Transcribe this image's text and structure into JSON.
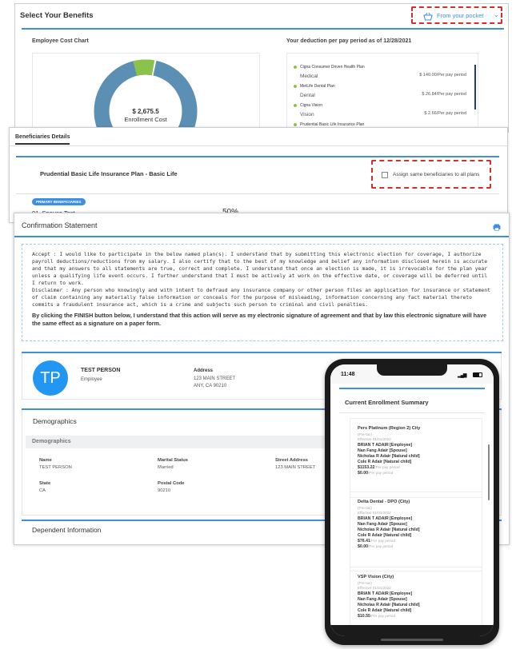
{
  "benefits": {
    "title": "Select Your Benefits",
    "pocket_label": "From your pocket",
    "cost_chart_title": "Employee Cost Chart",
    "total_amount": "$ 2,675.5",
    "total_label": "Enrollment Cost",
    "deduction_title": "Your deduction per pay period as of 12/28/2021",
    "plans": [
      {
        "name": "Cigna Consumer Driven Health Plan",
        "type": "Medical",
        "amount": "$ 140.00/Per pay period"
      },
      {
        "name": "MetLife Dental Plan",
        "type": "Dental",
        "amount": "$ 26.84/Per pay period"
      },
      {
        "name": "Cigna Vision",
        "type": "Vision",
        "amount": "$ 2.66/Per pay period"
      },
      {
        "name": "Prudential Basic Life Insurance Plan",
        "type": "",
        "amount": ""
      }
    ]
  },
  "beneficiaries": {
    "tab_label": "Beneficiaries Details",
    "plan_title": "Prudential Basic Life Insurance Plan - Basic Life",
    "assign_label": "Assign same beneficiaries to all plans",
    "primary_badge": "PRIMARY BENEFICIARIES",
    "first_name": "01. Spouse Test",
    "first_percent": "50%"
  },
  "confirmation": {
    "title": "Confirmation Statement",
    "accept_text": "Accept : I would like to participate in the below named plan(s). I understand that by submitting this electronic election for coverage, I authorize payroll deductions/reductions from my salary. I also certify that to the best of my knowledge and belief any information disclosed herein is accurate and that my answers to all statements are true, correct and complete. I understand that once an election is made, it is irrevocable for the plan year unless a qualifying life event occurs. I further understand that I must be actively at work on the effective date, or coverage will be deferred until I return to work.",
    "disclaimer_text": "Disclaimer : Any person who knowingly and with intent to defraud any insurance company or other person files an application for insurance or statement of claim containing any materially false information or conceals for the purpose of misleading, information concerning any fact material thereto commits a fraudulent insurance act, which is a crime and subjects such person to criminal and civil penalties.",
    "finish_text": "By clicking the FINISH button below, I understand that this action will serve as my electronic signature of agreement and that by law this electronic signature will have the same effect as a signature on a paper form."
  },
  "person": {
    "initials": "TP",
    "name": "TEST PERSON",
    "role": "Employee",
    "address_label": "Address",
    "address_line1": "123 MAIN STREET",
    "address_line2": "ANY, CA  90210"
  },
  "demographics": {
    "section_title": "Demographics",
    "sub_header": "Demographics",
    "fields": [
      {
        "label": "Name",
        "value": "TEST PERSON"
      },
      {
        "label": "Marital Status",
        "value": "Married"
      },
      {
        "label": "Street Address",
        "value": "123 MAIN STREET"
      },
      {
        "label": "State",
        "value": "CA"
      },
      {
        "label": "Postal Code",
        "value": "90210"
      }
    ]
  },
  "dependent": {
    "title": "Dependent Information"
  },
  "phone": {
    "time": "11:48",
    "summary_title": "Current Enrollment Summary",
    "plans": [
      {
        "name": "Pers Platinum (Region 2) City",
        "tax": "(Pre-tax)",
        "effective": "Effective 01/01/2022",
        "members": [
          "BRIAN T ADAIR [Employee]",
          "Nan Fang Adair [Spouse]",
          "Nicholas R Adair [Natural child]",
          "Cole R Adair [Natural child]"
        ],
        "cost1": "$1153.22",
        "cost1_suffix": "/Per pay period",
        "cost2": "$0.00",
        "cost2_suffix": "/Per pay period"
      },
      {
        "name": "Delta Dental - DPO (City)",
        "tax": "(Pre-tax)",
        "effective": "Effective 01/01/2022",
        "members": [
          "BRIAN T ADAIR [Employee]",
          "Nan Fang Adair [Spouse]",
          "Nicholas R Adair [Natural child]",
          "Cole R Adair [Natural child]"
        ],
        "cost1": "$76.41",
        "cost1_suffix": "/Per pay period",
        "cost2": "$0.00",
        "cost2_suffix": "/Per pay period"
      },
      {
        "name": "VSP Vision (City)",
        "tax": "(Pre-tax)",
        "effective": "Effective 01/01/2022",
        "members": [
          "BRIAN T ADAIR [Employee]",
          "Nan Fang Adair [Spouse]",
          "Nicholas R Adair [Natural child]",
          "Cole R Adair [Natural child]"
        ],
        "cost1": "$10.55",
        "cost1_suffix": "/Per pay period"
      }
    ]
  },
  "colors": {
    "accent": "#3d8fe0",
    "donut_blue": "#5b8fb3",
    "donut_green": "#8bc34a",
    "dash_red": "#d32f2f",
    "avatar": "#2196f3"
  }
}
